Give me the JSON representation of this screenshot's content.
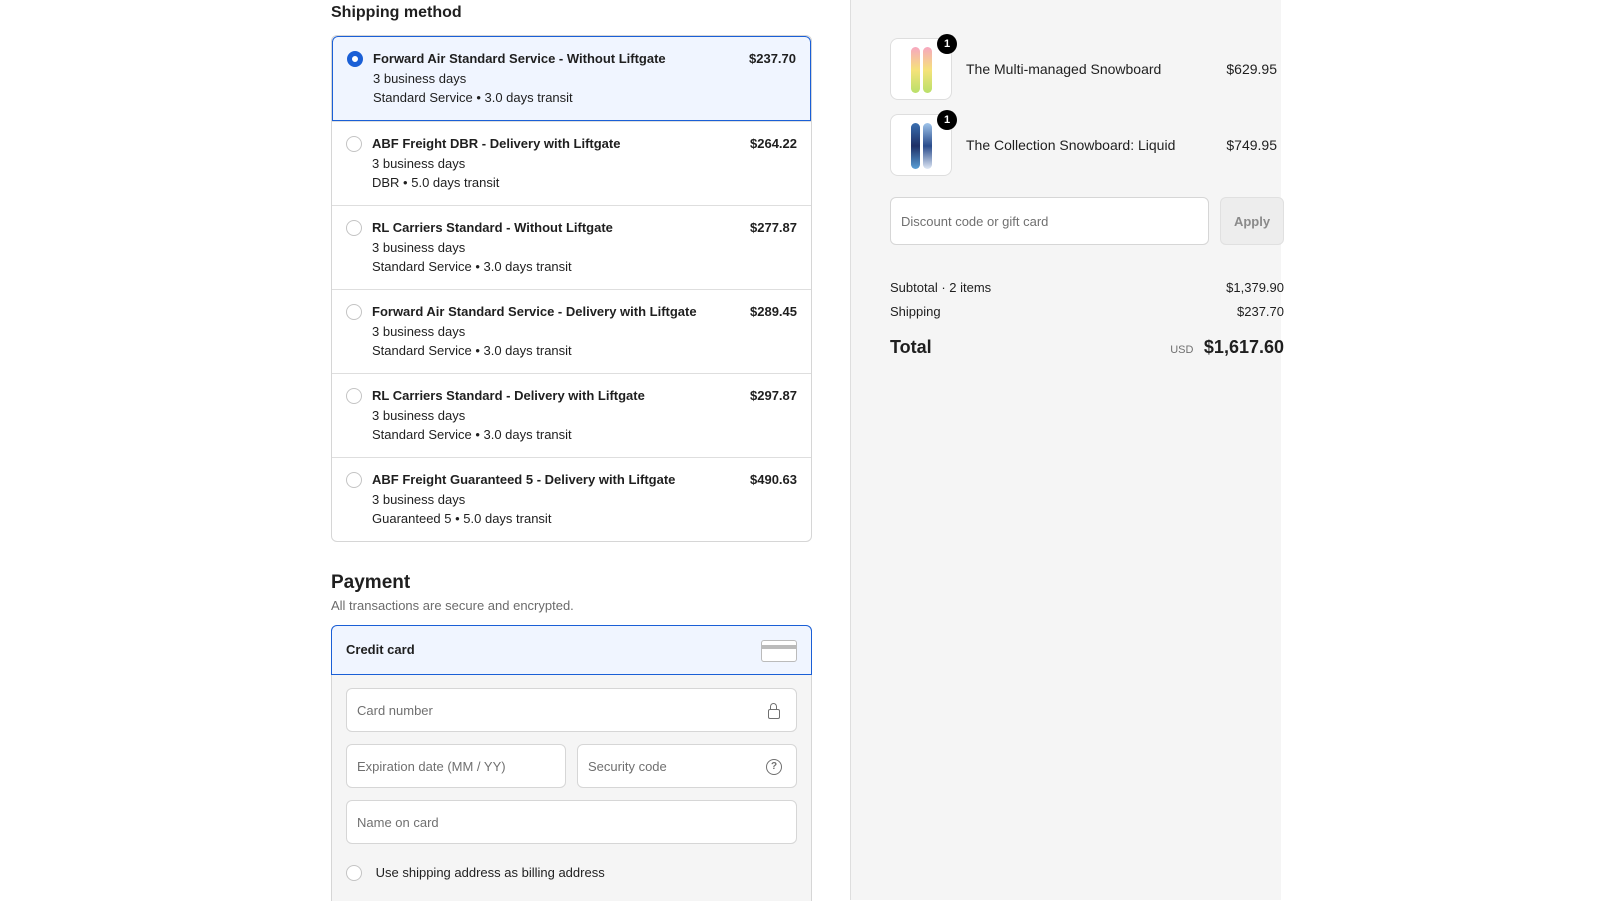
{
  "shipping": {
    "title": "Shipping method",
    "options": [
      {
        "name": "Forward Air Standard Service - Without Liftgate",
        "days": "3 business days",
        "detail": "Standard Service • 3.0 days transit",
        "price": "$237.70",
        "selected": true
      },
      {
        "name": "ABF Freight DBR - Delivery with Liftgate",
        "days": "3 business days",
        "detail": "DBR • 5.0 days transit",
        "price": "$264.22",
        "selected": false
      },
      {
        "name": "RL Carriers Standard - Without Liftgate",
        "days": "3 business days",
        "detail": "Standard Service • 3.0 days transit",
        "price": "$277.87",
        "selected": false
      },
      {
        "name": "Forward Air Standard Service - Delivery with Liftgate",
        "days": "3 business days",
        "detail": "Standard Service • 3.0 days transit",
        "price": "$289.45",
        "selected": false
      },
      {
        "name": "RL Carriers Standard - Delivery with Liftgate",
        "days": "3 business days",
        "detail": "Standard Service • 3.0 days transit",
        "price": "$297.87",
        "selected": false
      },
      {
        "name": "ABF Freight Guaranteed 5 - Delivery with Liftgate",
        "days": "3 business days",
        "detail": "Guaranteed 5 • 5.0 days transit",
        "price": "$490.63",
        "selected": false
      }
    ]
  },
  "payment": {
    "title": "Payment",
    "subtitle": "All transactions are secure and encrypted.",
    "method_label": "Credit card",
    "card_number_placeholder": "Card number",
    "expiration_placeholder": "Expiration date (MM / YY)",
    "security_code_placeholder": "Security code",
    "name_on_card_placeholder": "Name on card",
    "billing_checkbox_label": "Use shipping address as billing address",
    "billing_checkbox_checked": false
  },
  "summary": {
    "items": [
      {
        "name": "The Multi-managed Snowboard",
        "price": "$629.95",
        "quantity": "1"
      },
      {
        "name": "The Collection Snowboard: Liquid",
        "price": "$749.95",
        "quantity": "1"
      }
    ],
    "discount_placeholder": "Discount code or gift card",
    "apply_label": "Apply",
    "subtotal_label": "Subtotal · 2 items",
    "subtotal_value": "$1,379.90",
    "shipping_label": "Shipping",
    "shipping_value": "$237.70",
    "total_label": "Total",
    "currency": "USD",
    "total_value": "$1,617.60"
  },
  "colors": {
    "accent": "#1a5fd6",
    "selected_bg": "#f0f5ff",
    "summary_bg": "#f5f5f5"
  }
}
